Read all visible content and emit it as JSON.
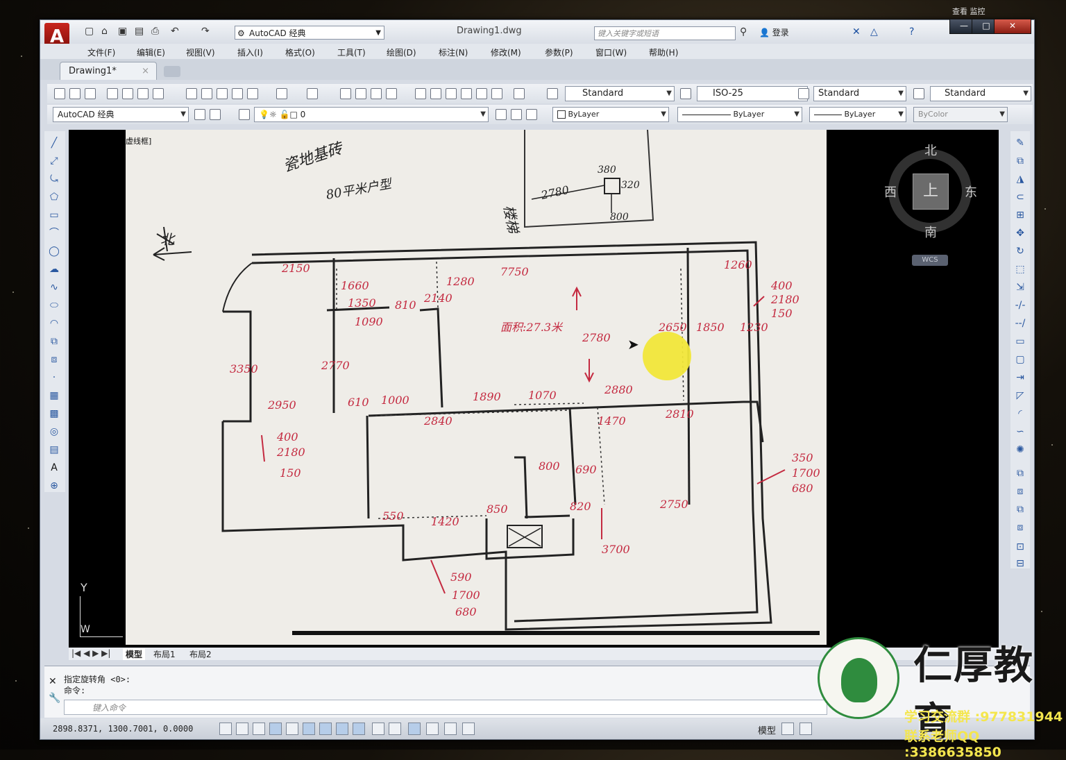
{
  "app": {
    "logo_letter": "A",
    "workspace": "AutoCAD 经典",
    "document_title": "Drawing1.dwg",
    "search_placeholder": "键入关键字或短语",
    "login": "登录",
    "window_buttons": [
      "—",
      "□",
      "✕"
    ]
  },
  "os_corner": "查看  监控",
  "menus": [
    "文件(F)",
    "编辑(E)",
    "视图(V)",
    "插入(I)",
    "格式(O)",
    "工具(T)",
    "绘图(D)",
    "标注(N)",
    "修改(M)",
    "参数(P)",
    "窗口(W)",
    "帮助(H)"
  ],
  "tabs": {
    "active": "Drawing1*",
    "close": "×"
  },
  "styles_toolbar": {
    "text_style": "Standard",
    "dim_style": "ISO-25",
    "table_style": "Standard",
    "mleader_style": "Standard"
  },
  "layers_toolbar": {
    "workspace": "AutoCAD 经典",
    "layer": "0",
    "color": "ByLayer",
    "linetype": "ByLayer",
    "lineweight": "ByLayer",
    "plotstyle": "ByColor"
  },
  "viewport_label": "虚线框]",
  "viewcube": {
    "top": "上",
    "north": "北",
    "south": "南",
    "east": "东",
    "west": "西",
    "wcs": "WCS"
  },
  "ucs": {
    "y": "Y",
    "w": "W"
  },
  "layout_tabs": [
    "模型",
    "布局1",
    "布局2"
  ],
  "command": {
    "history": [
      "指定旋转角 <0>:",
      "命令:"
    ],
    "input_placeholder": "键入命令"
  },
  "status": {
    "coordinates": "2898.8371, 1300.7001, 0.0000",
    "model": "模型"
  },
  "photo_notes": {
    "top_left": "瓷地基砖",
    "top_left2": "80平米户型",
    "north_arrow": "北",
    "top_mid": "楼梯",
    "stair_dim": "2780",
    "stair_w": "380",
    "stair_h": "320",
    "stair_d": "800",
    "dims": [
      "2150",
      "1660",
      "1350",
      "810",
      "1090",
      "2140",
      "1280",
      "7750",
      "1260",
      "2780",
      "2650",
      "1850",
      "1230",
      "3350",
      "2770",
      "2950",
      "610",
      "1000",
      "1890",
      "1070",
      "2880",
      "2840",
      "1470",
      "2810",
      "2750",
      "1420",
      "850",
      "550",
      "800",
      "690",
      "820",
      "3700"
    ],
    "area": "面积:27.3米",
    "side_right": [
      "400",
      "2180",
      "150"
    ],
    "side_left": [
      "400",
      "2180",
      "150"
    ],
    "side_right2": [
      "350",
      "1700",
      "680"
    ],
    "bottom": [
      "590",
      "1700",
      "680"
    ]
  },
  "brand": {
    "name": "仁厚教育",
    "group": "学习交流群 :977831944",
    "qq": "联系老师QQ :3386635850",
    "seal": "仁厚教育"
  }
}
